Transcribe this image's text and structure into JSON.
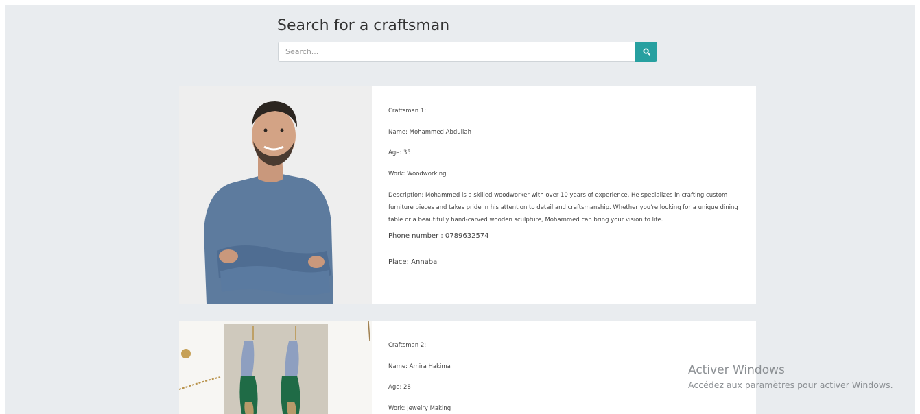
{
  "search": {
    "title": "Search for a craftsman",
    "placeholder": "Search..."
  },
  "craftsmen": [
    {
      "heading": "Craftsman 1:",
      "name": "Name:  Mohammed Abdullah",
      "age": "Age: 35",
      "work": "Work: Woodworking",
      "description": "Description: Mohammed is a skilled woodworker with over 10 years of experience. He specializes in crafting custom furniture pieces and takes pride in his attention to detail and craftsmanship. Whether you're looking for a unique dining table or a beautifully hand-carved wooden sculpture, Mohammed can bring your vision to life.",
      "phone": "Phone number : 0789632574",
      "place": "Place: Annaba"
    },
    {
      "heading": "Craftsman 2:",
      "name": "Name:  Amira Hakima",
      "age": "Age: 28",
      "work": "Work: Jewelry Making"
    }
  ],
  "watermark": {
    "title": "Activer Windows",
    "subtitle": "Accédez aux paramètres pour activer Windows."
  },
  "colors": {
    "accent": "#27a0a0",
    "background": "#e9ecef"
  }
}
